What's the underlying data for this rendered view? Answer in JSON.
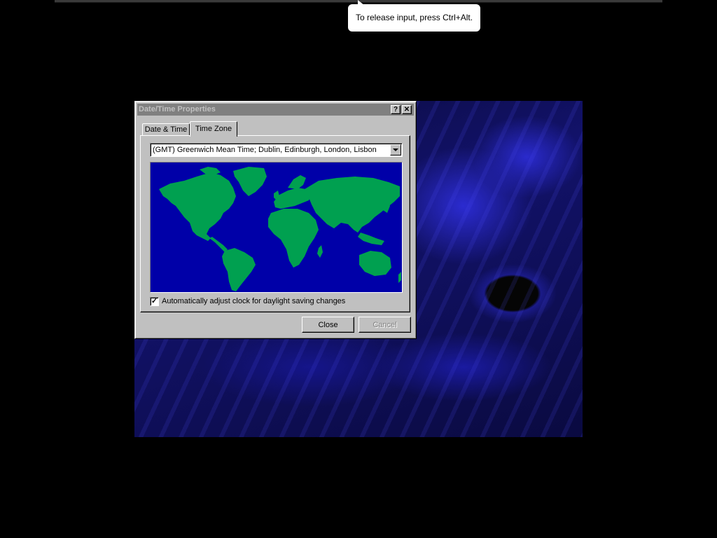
{
  "tooltip": {
    "text": "To release input, press Ctrl+Alt."
  },
  "window": {
    "title": "Date/Time Properties",
    "help_glyph": "?",
    "close_glyph": "✕",
    "active": false
  },
  "tabs": [
    {
      "label": "Date & Time",
      "selected": false
    },
    {
      "label": "Time Zone",
      "selected": true
    }
  ],
  "timezone": {
    "selected": "(GMT) Greenwich Mean Time; Dublin, Edinburgh, London, Lisbon"
  },
  "map": {
    "ocean_color": "#0000a8",
    "land_color": "#00a050"
  },
  "dst": {
    "label": "Automatically adjust clock for daylight saving changes",
    "checked": true,
    "check_glyph": "✓"
  },
  "buttons": {
    "close": {
      "label": "Close",
      "enabled": true
    },
    "cancel": {
      "label": "Cancel",
      "enabled": false
    }
  }
}
